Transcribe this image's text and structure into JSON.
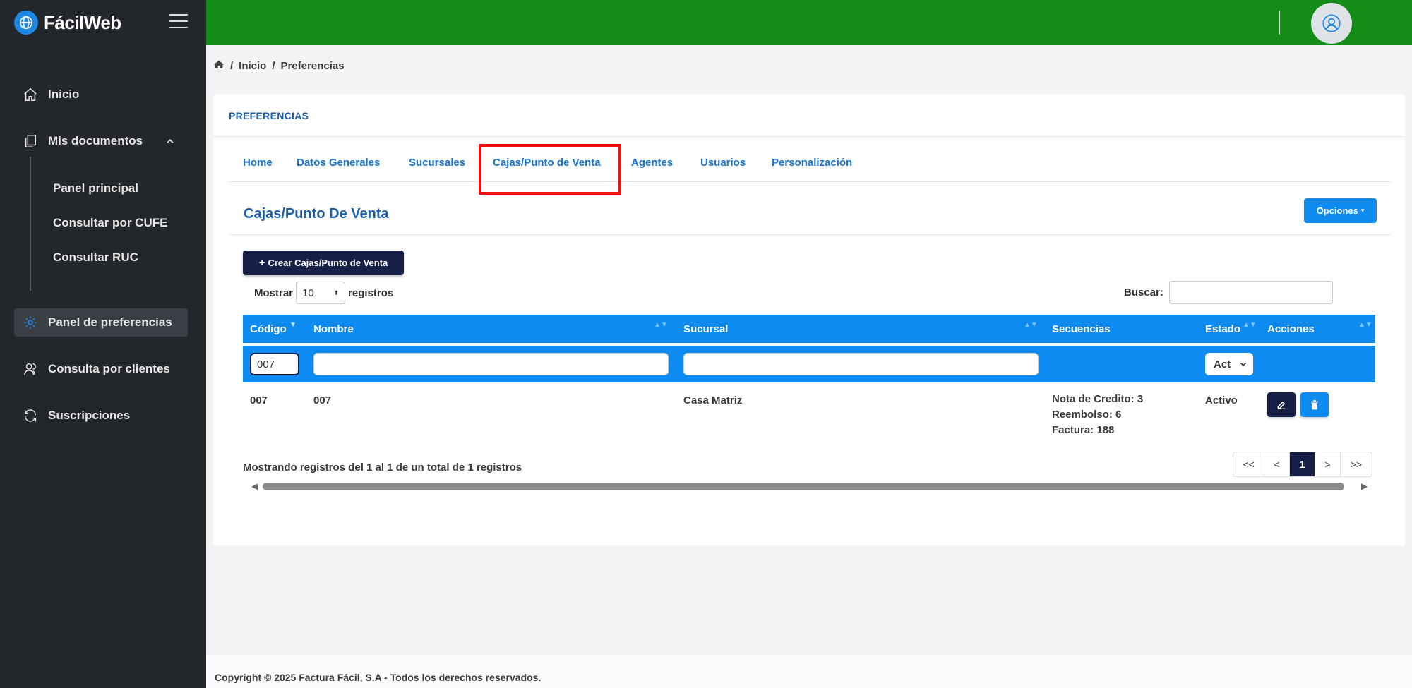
{
  "app": {
    "brand": "FácilWeb"
  },
  "sidebar": {
    "items": [
      {
        "label": "Inicio",
        "icon": "home-icon"
      },
      {
        "label": "Mis documentos",
        "icon": "documents-icon"
      },
      {
        "label": "Panel de preferencias",
        "icon": "gear-icon"
      },
      {
        "label": "Consulta por clientes",
        "icon": "users-icon"
      },
      {
        "label": "Suscripciones",
        "icon": "refresh-icon"
      }
    ],
    "subitems": [
      "Panel principal",
      "Consultar por CUFE",
      "Consultar RUC"
    ]
  },
  "breadcrumb": {
    "home": "Inicio",
    "current": "Preferencias"
  },
  "card": {
    "header": "PREFERENCIAS"
  },
  "tabs": [
    "Home",
    "Datos Generales",
    "Sucursales",
    "Cajas/Punto de Venta",
    "Agentes",
    "Usuarios",
    "Personalización"
  ],
  "section": {
    "title": "Cajas/Punto De Venta",
    "options_label": "Opciones",
    "create_label": "Crear Cajas/Punto de Venta"
  },
  "list": {
    "show_label": "Mostrar",
    "show_value": "10",
    "records_label": "registros",
    "search_label": "Buscar:",
    "search_value": ""
  },
  "table": {
    "headers": [
      "Código",
      "Nombre",
      "Sucursal",
      "Secuencias",
      "Estado",
      "Acciones"
    ],
    "filters": {
      "codigo": "007",
      "nombre": "",
      "sucursal": "",
      "estado": "Act"
    },
    "rows": [
      {
        "codigo": "007",
        "nombre": "007",
        "sucursal": "Casa Matriz",
        "secuencias": [
          "Nota de Credito: 3",
          "Reembolso: 6",
          "Factura: 188"
        ],
        "estado": "Activo"
      }
    ]
  },
  "pagination": {
    "info": "Mostrando registros del 1 al 1 de un total de 1 registros",
    "first": "<<",
    "prev": "<",
    "current": "1",
    "next": ">",
    "last": ">>"
  },
  "footer": {
    "text": "Copyright © 2025 Factura Fácil, S.A - Todos los derechos reservados."
  },
  "colors": {
    "sidebar": "#23262b",
    "topbar": "#138d17",
    "primary": "#0d8bf0",
    "navy": "#171f47",
    "highlight": "#ee1111"
  }
}
